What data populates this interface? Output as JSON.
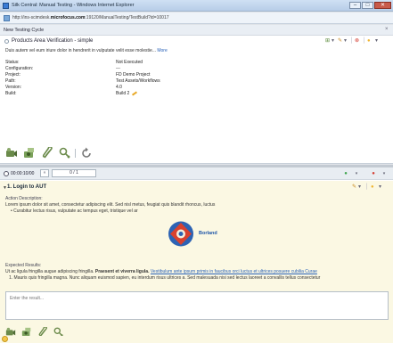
{
  "window": {
    "title": "Silk Central: Manual Testing - Windows Internet Explorer",
    "min_glyph": "–",
    "max_glyph": "□",
    "close_glyph": "✕"
  },
  "address": {
    "url_prefix": "http://ins-scimdesk.",
    "url_domain": "microfocus.com",
    "url_suffix": ":19120/ManualTesting/TestBuild?id=10017"
  },
  "cycle": {
    "header": "New Testing Cycle",
    "close_glyph": "×",
    "test_title": "Products Area Verification - simple",
    "description": "Duis autem vel eum iriure dolor in hendrerit in vulputate velit esse molestie...",
    "more_link": "More",
    "properties": [
      {
        "key": "Status:",
        "value": "Not Executed"
      },
      {
        "key": "Configuration:",
        "value": "---"
      },
      {
        "key": "Project:",
        "value": "FD Demo Project"
      },
      {
        "key": "Path:",
        "value": "Test Assets/Workflows"
      },
      {
        "key": "Version:",
        "value": "4.0"
      },
      {
        "key": "Build:",
        "value": "Build 2"
      }
    ],
    "title_action_glyphs": [
      "⊞",
      "▾",
      "✎",
      "▾",
      "│",
      "⊗",
      "│",
      "●",
      "▾"
    ]
  },
  "steps": {
    "timer": "00:00:10/00",
    "nav_glyph": "«",
    "counter": "0 / 1",
    "status_pass_glyph": "●",
    "status_fail_glyph": "●",
    "dropdown_glyph": "▾",
    "title": "1. Login to AUT",
    "caret_glyph": "▼",
    "action_label": "Action Description:",
    "action_text": "Lorem ipsum dolor sit amet, consectetur adipiscing elit. Sed nisl metus, feugiat quis blandit rhoncus, luctus",
    "action_bullet": "•  Curabitur lectus risus, vulputate ac tempus eget, tristique vel ar",
    "logo_text": "Borland",
    "expected_label": "Expected Results:",
    "expected_pre": "Ut ac ligula fringilla augue adipiscing fringilla. ",
    "expected_bold": "Praesent et viverra ligula.",
    "expected_link": "Vestibulum ante ipsum primis in faucibus orci luctus et ultrices posuere cubilia Curae",
    "expected_item": "1.  Mauris quis fringilla magna. Nunc aliquam euismod sapien, eu interdum risus ultrices a. Sed malesuada nisi sed lectus laoreet a convallis tellus consectetur",
    "result_placeholder": "Enter the result...",
    "step_action_glyphs": [
      "✎",
      "▾",
      "│",
      "●",
      "▾"
    ]
  },
  "colors": {
    "accent_blue": "#2a62b8",
    "step_bg": "#fbf8e3",
    "pass_green": "#3aa34a",
    "fail_red": "#d43a2f",
    "warn_yellow": "#f0b632"
  }
}
